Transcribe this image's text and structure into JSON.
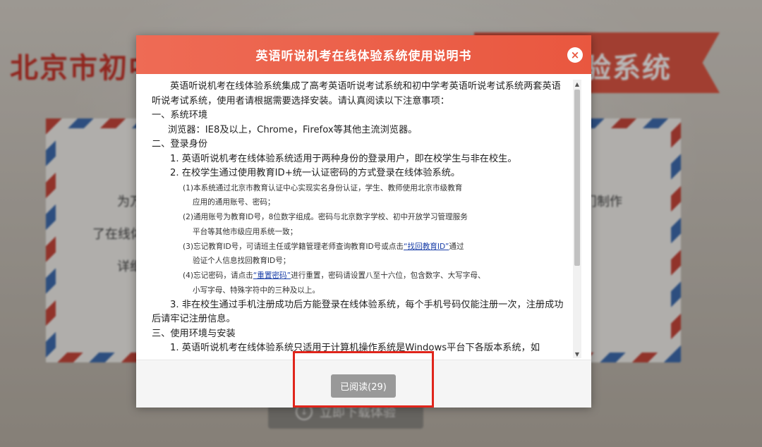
{
  "background": {
    "title_left": "北京市初中",
    "title_right": "验系统",
    "line1_left": "为万",
    "line1_right": "门制作",
    "line2_left": "了在线体",
    "line3_left": "详细",
    "download_button": "立即下载体验"
  },
  "modal": {
    "title": "英语听说机考在线体验系统使用说明书",
    "close_icon": "×",
    "intro": "英语听说机考在线体验系统集成了高考英语听说考试系统和初中学考英语听说考试系统两套英语听说考试系统，使用者请根据需要选择安装。请认真阅读以下注意事项：",
    "sec1": "一、系统环境",
    "sec1_item": "浏览器：IE8及以上，Chrome，Firefox等其他主流浏览器。",
    "sec2": "二、登录身份",
    "sec2_item1": "1. 英语听说机考在线体验系统适用于两种身份的登录用户，即在校学生与非在校生。",
    "sec2_item2": "2. 在校学生通过使用教育ID+统一认证密码的方式登录在线体验系统。",
    "sub1_a": "(1)本系统通过北京市教育认证中心实现实名身份认证，学生、教师使用北京市级教育",
    "sub1_b": "应用的通用账号、密码；",
    "sub2_a": "(2)通用账号为教育ID号，8位数字组成。密码与北京数字学校、初中开放学习管理服务",
    "sub2_b": "平台等其他市级应用系统一致；",
    "sub3_a_pre": "(3)忘记教育ID号，可请班主任或学籍管理老师查询教育ID号或点击",
    "sub3_link": "“找回教育ID”",
    "sub3_a_post": "通过",
    "sub3_b": "验证个人信息找回教育ID号；",
    "sub4_a_pre": "(4)忘记密码，请点击",
    "sub4_link": "“重置密码”",
    "sub4_a_post": "进行重置，密码请设置八至十六位，包含数字、大写字母、",
    "sub4_b": "小写字母、特殊字符中的三种及以上。",
    "sec2_item3": "3. 非在校生通过手机注册成功后方能登录在线体验系统，每个手机号码仅能注册一次，注册成功后请牢记注册信息。",
    "sec3": "三、使用环境与安装",
    "sec3_item1": "1. 英语听说机考在线体验系统只适用于计算机操作系统是Windows平台下各版本系统，如",
    "read_button": "已阅读(29)"
  }
}
